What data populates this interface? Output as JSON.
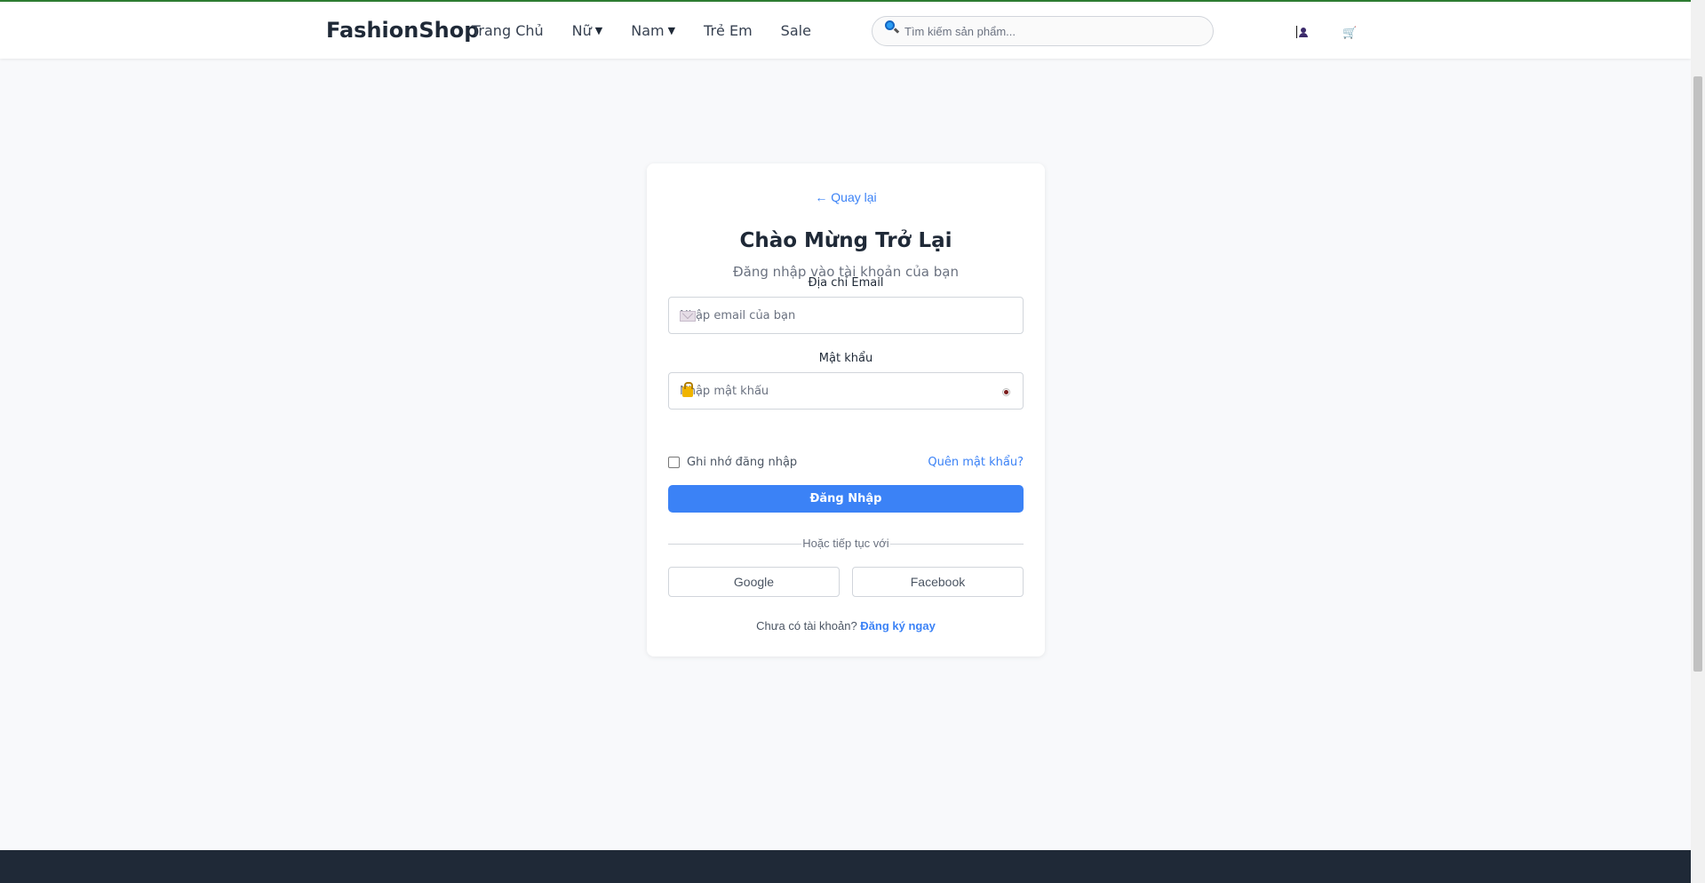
{
  "header": {
    "logo": "FashionShop",
    "nav": [
      {
        "label": "Trang Chủ",
        "dropdown": false
      },
      {
        "label": "Nữ",
        "dropdown": true
      },
      {
        "label": "Nam",
        "dropdown": true
      },
      {
        "label": "Trẻ Em",
        "dropdown": false
      },
      {
        "label": "Sale",
        "dropdown": false
      }
    ],
    "search_placeholder": "Tìm kiếm sản phẩm...",
    "icons": {
      "search": "search-icon",
      "user": "user-icon",
      "cart": "cart-icon"
    }
  },
  "login": {
    "back_link": "← Quay lại",
    "title": "Chào Mừng Trở Lại",
    "subtitle": "Đăng nhập vào tài khoản của bạn",
    "email_label": "Địa chỉ Email",
    "email_placeholder": "Nhập email của bạn",
    "password_label": "Mật khẩu",
    "password_placeholder": "Nhập mật khẩu",
    "remember_label": "Ghi nhớ đăng nhập",
    "remember_checked": false,
    "forgot_link": "Quên mật khẩu?",
    "submit_label": "Đăng Nhập",
    "divider_text": "Hoặc tiếp tục với",
    "google_label": "Google",
    "facebook_label": "Facebook",
    "signup_prompt": "Chưa có tài khoản?",
    "signup_link": "Đăng ký ngay"
  },
  "colors": {
    "accent": "#3b82f6",
    "page_background": "#f8f9fb",
    "footer": "#1f2937",
    "top_accent": "#2e7d32"
  }
}
